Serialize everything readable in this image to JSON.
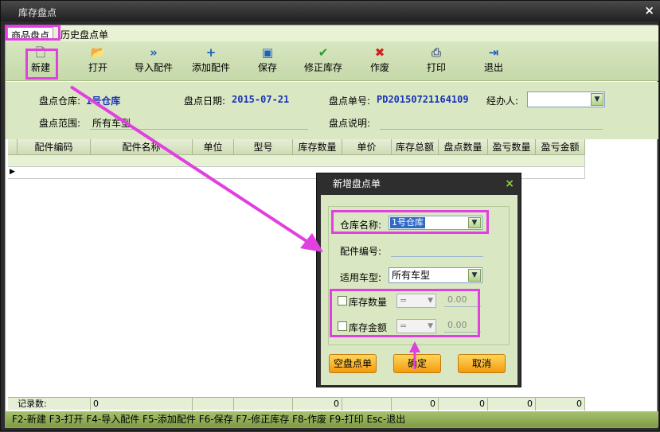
{
  "window": {
    "title": "库存盘点",
    "close": "×"
  },
  "tabs": [
    {
      "label": "商品盘点"
    },
    {
      "label": "历史盘点单"
    }
  ],
  "toolbar": {
    "new": "新建",
    "open": "打开",
    "import": "导入配件",
    "add": "添加配件",
    "save": "保存",
    "fix": "修正库存",
    "void": "作废",
    "print": "打印",
    "exit": "退出"
  },
  "form": {
    "warehouse_label": "盘点仓库:",
    "warehouse_value": "1号仓库",
    "date_label": "盘点日期:",
    "date_value": "2015-07-21",
    "no_label": "盘点单号:",
    "no_value": "PD20150721164109",
    "handler_label": "经办人:",
    "handler_value": "",
    "range_label": "盘点范围:",
    "range_value": "所有车型",
    "note_label": "盘点说明:",
    "note_value": ""
  },
  "grid": {
    "columns": [
      "配件编码",
      "配件名称",
      "单位",
      "型号",
      "库存数量",
      "单价",
      "库存总额",
      "盘点数量",
      "盈亏数量",
      "盈亏金额"
    ],
    "footer_label": "记录数:",
    "footer_values": [
      "0",
      "",
      "",
      "",
      "0",
      "",
      "0",
      "0",
      "0",
      "0"
    ]
  },
  "statusbar": {
    "text": "F2-新建 F3-打开 F4-导入配件 F5-添加配件 F6-保存 F7-修正库存 F8-作废 F9-打印 Esc-退出"
  },
  "dialog": {
    "title": "新增盘点单",
    "close": "×",
    "warehouse_label": "仓库名称:",
    "warehouse_value": "1号仓库",
    "part_label": "配件编号:",
    "part_value": "",
    "model_label": "适用车型:",
    "model_value": "所有车型",
    "stock_qty_label": "库存数量",
    "stock_qty_op": "=",
    "stock_qty_value": "0.00",
    "stock_amt_label": "库存金额",
    "stock_amt_op": "=",
    "stock_amt_value": "0.00",
    "btn_empty": "空盘点单",
    "btn_ok": "确定",
    "btn_cancel": "取消"
  },
  "colors": {
    "accent": "#e040e0",
    "toolbar_bg": "#c6d9a9",
    "button_orange": "#f39a10",
    "link_blue": "#1a33b8"
  }
}
